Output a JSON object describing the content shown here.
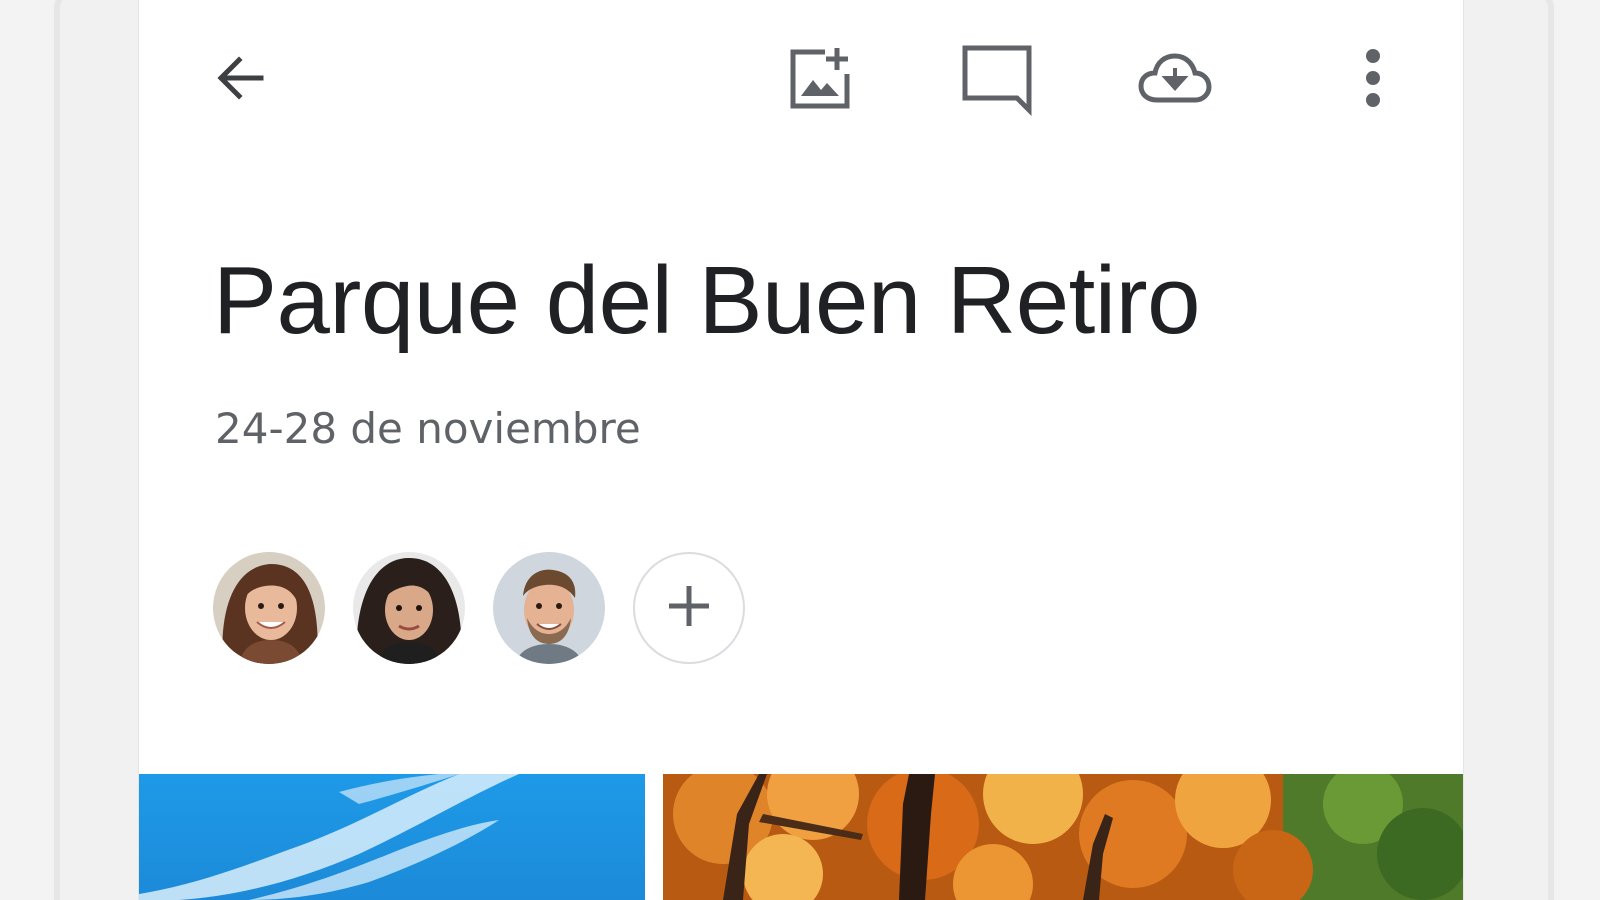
{
  "app": {
    "toolbar": {
      "back_icon": "arrow-back-icon",
      "add_photo_icon": "add-photo-icon",
      "comment_icon": "comment-icon",
      "download_icon": "cloud-download-icon",
      "more_icon": "more-vertical-icon"
    },
    "album": {
      "title": "Parque del Buen Retiro",
      "date_range": "24-28 de noviembre"
    },
    "people": {
      "avatars": [
        "avatar-woman-smiling",
        "avatar-woman-curly-hair",
        "avatar-man-beard"
      ],
      "add_icon": "plus-icon"
    },
    "photos": [
      "blue-sky-photo",
      "autumn-trees-photo"
    ]
  },
  "colors": {
    "title": "#202124",
    "subtitle": "#5f6368",
    "icon": "#5f6368",
    "background": "#ffffff"
  }
}
